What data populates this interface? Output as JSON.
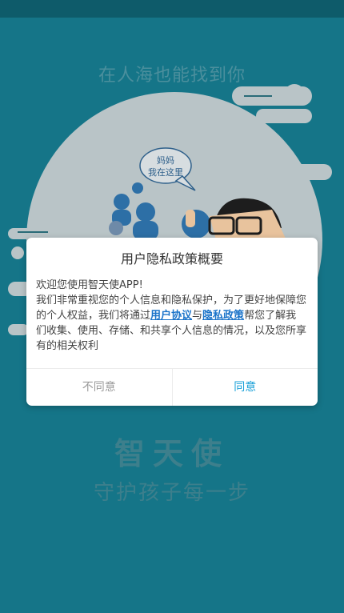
{
  "splash": {
    "tagline": "在人海也能找到你",
    "speech_bubble_line1": "妈妈",
    "speech_bubble_line2": "我在这里",
    "brand_name": "智天使",
    "slogan": "守护孩子每一步"
  },
  "dialog": {
    "title": "用户隐私政策概要",
    "greeting": "欢迎您使用智天使APP!",
    "body_part1": "我们非常重视您的个人信息和隐私保护，为了更好地保障您的个人权益，我们将通过",
    "user_agreement_link": "用户协议",
    "conjunction": "与",
    "privacy_policy_link": "隐私政策",
    "body_part2": "帮您了解我们收集、使用、存储、和共享个人信息的情况，以及您所享有的相关权利",
    "disagree_label": "不同意",
    "agree_label": "同意"
  },
  "colors": {
    "background": "#157588",
    "link": "#1a73c9",
    "agree": "#1aa0d8",
    "disagree": "#9a9a9a"
  }
}
